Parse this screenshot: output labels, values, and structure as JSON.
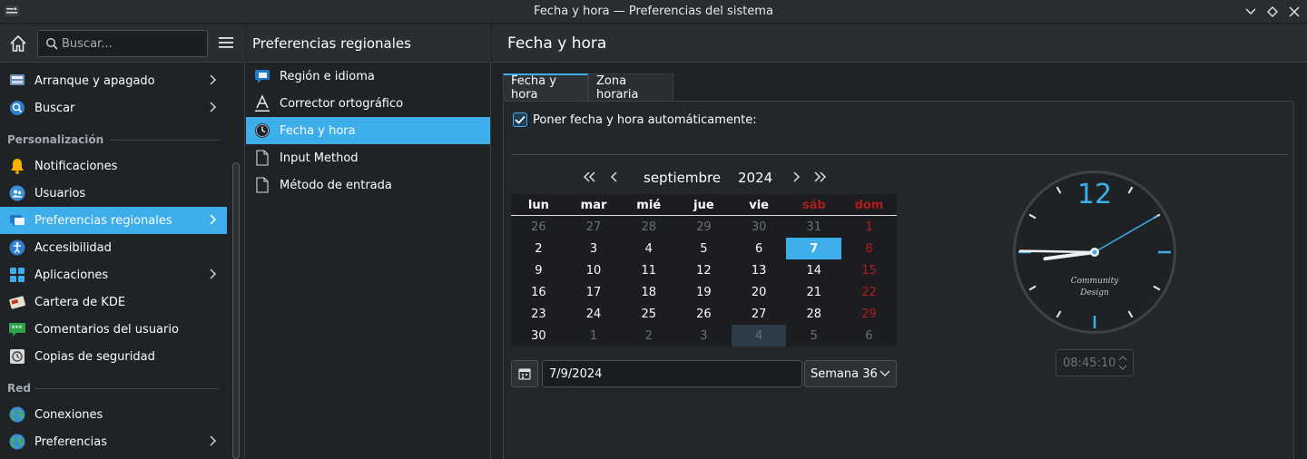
{
  "window": {
    "title": "Fecha y hora — Preferencias del sistema"
  },
  "sidebar": {
    "search_placeholder": "Buscar...",
    "items": [
      {
        "label": "Arranque y apagado",
        "has_children": true,
        "icon": "startup-icon"
      },
      {
        "label": "Buscar",
        "has_children": true,
        "icon": "search-icon"
      }
    ],
    "sections": [
      {
        "title": "Personalización",
        "items": [
          {
            "label": "Notificaciones",
            "has_children": false,
            "icon": "bell-icon"
          },
          {
            "label": "Usuarios",
            "has_children": false,
            "icon": "users-icon"
          },
          {
            "label": "Preferencias regionales",
            "has_children": true,
            "active": true,
            "icon": "regional-icon"
          },
          {
            "label": "Accesibilidad",
            "has_children": false,
            "icon": "accessibility-icon"
          },
          {
            "label": "Aplicaciones",
            "has_children": true,
            "icon": "apps-icon"
          },
          {
            "label": "Cartera de KDE",
            "has_children": false,
            "icon": "wallet-icon"
          },
          {
            "label": "Comentarios del usuario",
            "has_children": false,
            "icon": "feedback-icon"
          },
          {
            "label": "Copias de seguridad",
            "has_children": false,
            "icon": "backup-icon"
          }
        ]
      },
      {
        "title": "Red",
        "items": [
          {
            "label": "Conexiones",
            "has_children": false,
            "icon": "globe-icon"
          },
          {
            "label": "Preferencias",
            "has_children": true,
            "icon": "globe-icon"
          }
        ]
      }
    ]
  },
  "middle": {
    "title": "Preferencias regionales",
    "items": [
      {
        "label": "Región e idioma",
        "icon": "chat-icon"
      },
      {
        "label": "Corrector ortográfico",
        "icon": "spellcheck-icon"
      },
      {
        "label": "Fecha y hora",
        "icon": "clock-icon",
        "active": true
      },
      {
        "label": "Input Method",
        "icon": "document-icon"
      },
      {
        "label": "Método de entrada",
        "icon": "document-icon"
      }
    ]
  },
  "main": {
    "title": "Fecha y hora",
    "tabs": [
      {
        "label": "Fecha y hora",
        "active": true
      },
      {
        "label": "Zona horaria",
        "active": false
      }
    ],
    "auto_label": "Poner fecha y hora automáticamente:",
    "auto_checked": true
  },
  "calendar": {
    "month": "septiembre",
    "year": "2024",
    "weekdays": [
      "lun",
      "mar",
      "mié",
      "jue",
      "vie",
      "sáb",
      "dom"
    ],
    "weeks": [
      [
        "26",
        "27",
        "28",
        "29",
        "30",
        "31",
        "1"
      ],
      [
        "2",
        "3",
        "4",
        "5",
        "6",
        "7",
        "8"
      ],
      [
        "9",
        "10",
        "11",
        "12",
        "13",
        "14",
        "15"
      ],
      [
        "16",
        "17",
        "18",
        "19",
        "20",
        "21",
        "22"
      ],
      [
        "23",
        "24",
        "25",
        "26",
        "27",
        "28",
        "29"
      ],
      [
        "30",
        "1",
        "2",
        "3",
        "4",
        "5",
        "6"
      ]
    ],
    "selected_day": "7",
    "date_value": "7/9/2024",
    "week_label": "Semana 36"
  },
  "clock": {
    "numeral": "12",
    "brand_line1": "Community",
    "brand_line2": "Design",
    "hours": 8,
    "minutes": 45,
    "seconds": 10,
    "time_value": "08:45:10",
    "accent_color": "#3daee9"
  },
  "colors": {
    "accent": "#3daee9",
    "weekend": "#b31c1c"
  }
}
